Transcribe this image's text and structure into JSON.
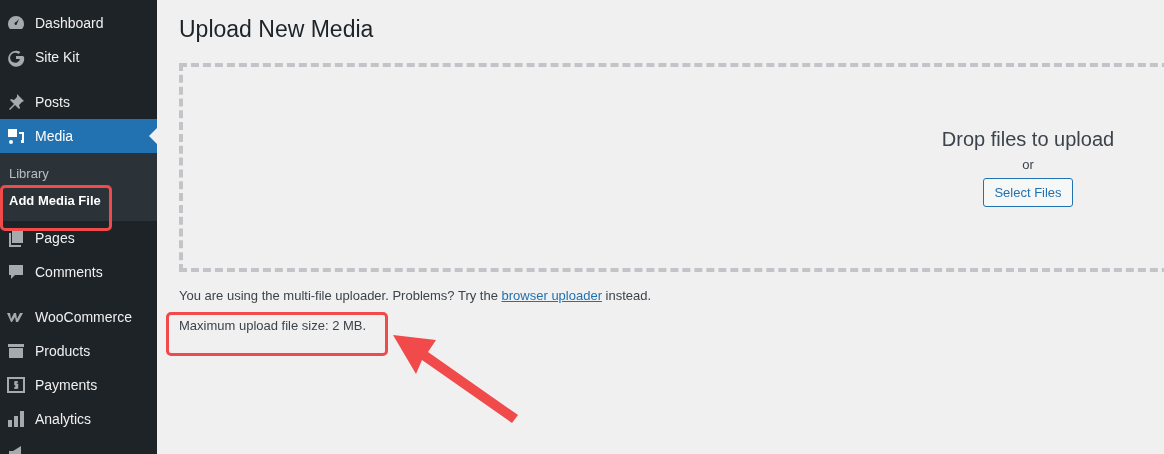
{
  "sidebar": {
    "groups": [
      {
        "items": [
          {
            "label": "Dashboard",
            "selected": false
          },
          {
            "label": "Site Kit",
            "selected": false
          }
        ]
      },
      {
        "items": [
          {
            "label": "Posts",
            "selected": false
          },
          {
            "label": "Media",
            "selected": true,
            "children": [
              {
                "label": "Library",
                "selected": false
              },
              {
                "label": "Add Media File",
                "selected": true
              }
            ]
          },
          {
            "label": "Pages",
            "selected": false
          },
          {
            "label": "Comments",
            "selected": false
          }
        ]
      },
      {
        "items": [
          {
            "label": "WooCommerce",
            "selected": false
          },
          {
            "label": "Products",
            "selected": false
          },
          {
            "label": "Payments",
            "selected": false
          },
          {
            "label": "Analytics",
            "selected": false
          }
        ]
      }
    ]
  },
  "page": {
    "title": "Upload New Media",
    "dropzone": {
      "heading": "Drop files to upload",
      "separator": "or",
      "button": "Select Files"
    },
    "notice": {
      "before": "You are using the multi-file uploader. Problems? Try the ",
      "link": "browser uploader",
      "after": " instead."
    },
    "max_size": "Maximum upload file size: 2 MB."
  }
}
